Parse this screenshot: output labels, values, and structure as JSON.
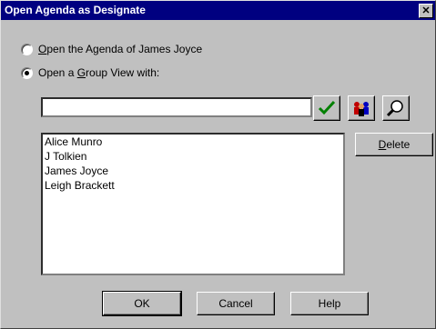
{
  "window": {
    "title": "Open Agenda as Designate",
    "close_glyph": "✕"
  },
  "options": {
    "agenda": {
      "prefix": "",
      "accel": "O",
      "rest": "pen the Agenda of James Joyce",
      "checked": false
    },
    "group": {
      "prefix": "Open a ",
      "accel": "G",
      "rest": "roup View with:",
      "checked": true
    }
  },
  "search": {
    "value": "",
    "placeholder": ""
  },
  "toolbar": {
    "icons": [
      "checkmark-icon",
      "address-book-icon",
      "magnifier-icon"
    ],
    "colors": {
      "check": "#008000",
      "people_red": "#c00000",
      "people_blue": "#0000c0"
    }
  },
  "list": {
    "items": [
      "Alice Munro",
      "J Tolkien",
      "James Joyce",
      "Leigh Brackett"
    ]
  },
  "buttons": {
    "delete": {
      "accel": "D",
      "rest": "elete"
    },
    "ok": "OK",
    "cancel": "Cancel",
    "help": "Help"
  }
}
